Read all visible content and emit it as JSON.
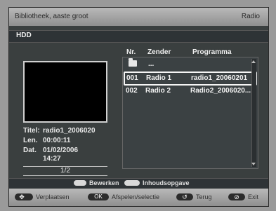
{
  "topbar": {
    "left_text": "Bibliotheek, aaste groot",
    "right_text": "Radio"
  },
  "section": {
    "title": "HDD"
  },
  "list": {
    "headers": {
      "nr": "Nr.",
      "zender": "Zender",
      "programma": "Programma"
    },
    "folder_label": "...",
    "rows": [
      {
        "nr": "001",
        "zender": "Radio 1",
        "programma": "radio1_20060201",
        "selected": true
      },
      {
        "nr": "002",
        "zender": "Radio 2",
        "programma": "Radio2_2006020..."
      }
    ]
  },
  "info": {
    "title_key": "Titel:",
    "title_val": "radio1_2006020",
    "len_key": "Len.",
    "len_val": "00:00:11",
    "dat_key": "Dat.",
    "dat_val": "01/02/2006",
    "time_val": "14:27",
    "page": "1/2"
  },
  "actions": {
    "edit": "Bewerken",
    "content": "Inhoudsopgave"
  },
  "bottom": {
    "nav": "Verplaatsen",
    "ok": "Afspelen/selectie",
    "back": "Terug",
    "exit": "Exit"
  }
}
